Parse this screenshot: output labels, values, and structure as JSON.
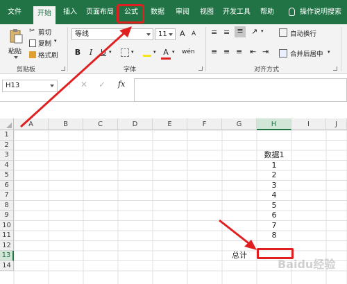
{
  "menu": {
    "tabs": [
      "文件",
      "开始",
      "插入",
      "页面布局",
      "公式",
      "数据",
      "审阅",
      "视图",
      "开发工具",
      "帮助"
    ],
    "active_tab": "开始",
    "highlighted_tab": "公式",
    "search_label": "操作说明搜索"
  },
  "ribbon": {
    "clipboard": {
      "paste": "粘贴",
      "cut": "剪切",
      "copy": "复制",
      "format_painter": "格式刷",
      "group_label": "剪贴板"
    },
    "font": {
      "name": "等线",
      "size": "11",
      "grow": "A",
      "shrink": "A",
      "bold": "B",
      "italic": "I",
      "underline": "U",
      "group_label": "字体",
      "font_color_letter": "A"
    },
    "alignment": {
      "wrap_text": "自动换行",
      "merge_center": "合并后居中",
      "group_label": "对齐方式"
    }
  },
  "formula_bar": {
    "name_box": "H13",
    "fx": "fx",
    "formula": ""
  },
  "grid": {
    "columns": [
      "A",
      "B",
      "C",
      "D",
      "E",
      "F",
      "G",
      "H",
      "I",
      "J"
    ],
    "selected_column": "H",
    "rows": [
      "1",
      "2",
      "3",
      "4",
      "5",
      "6",
      "7",
      "8",
      "9",
      "10",
      "11",
      "12",
      "13",
      "14"
    ],
    "selected_row": "13",
    "cells": {
      "H3": "数据1",
      "H4": "1",
      "H5": "2",
      "H6": "3",
      "H7": "4",
      "H8": "5",
      "H9": "6",
      "H10": "7",
      "H11": "8",
      "G13": "总计"
    },
    "active_cell": "H13"
  },
  "colors": {
    "accent": "#217346",
    "annotation": "#e02020"
  },
  "watermark": "Baidu经验"
}
